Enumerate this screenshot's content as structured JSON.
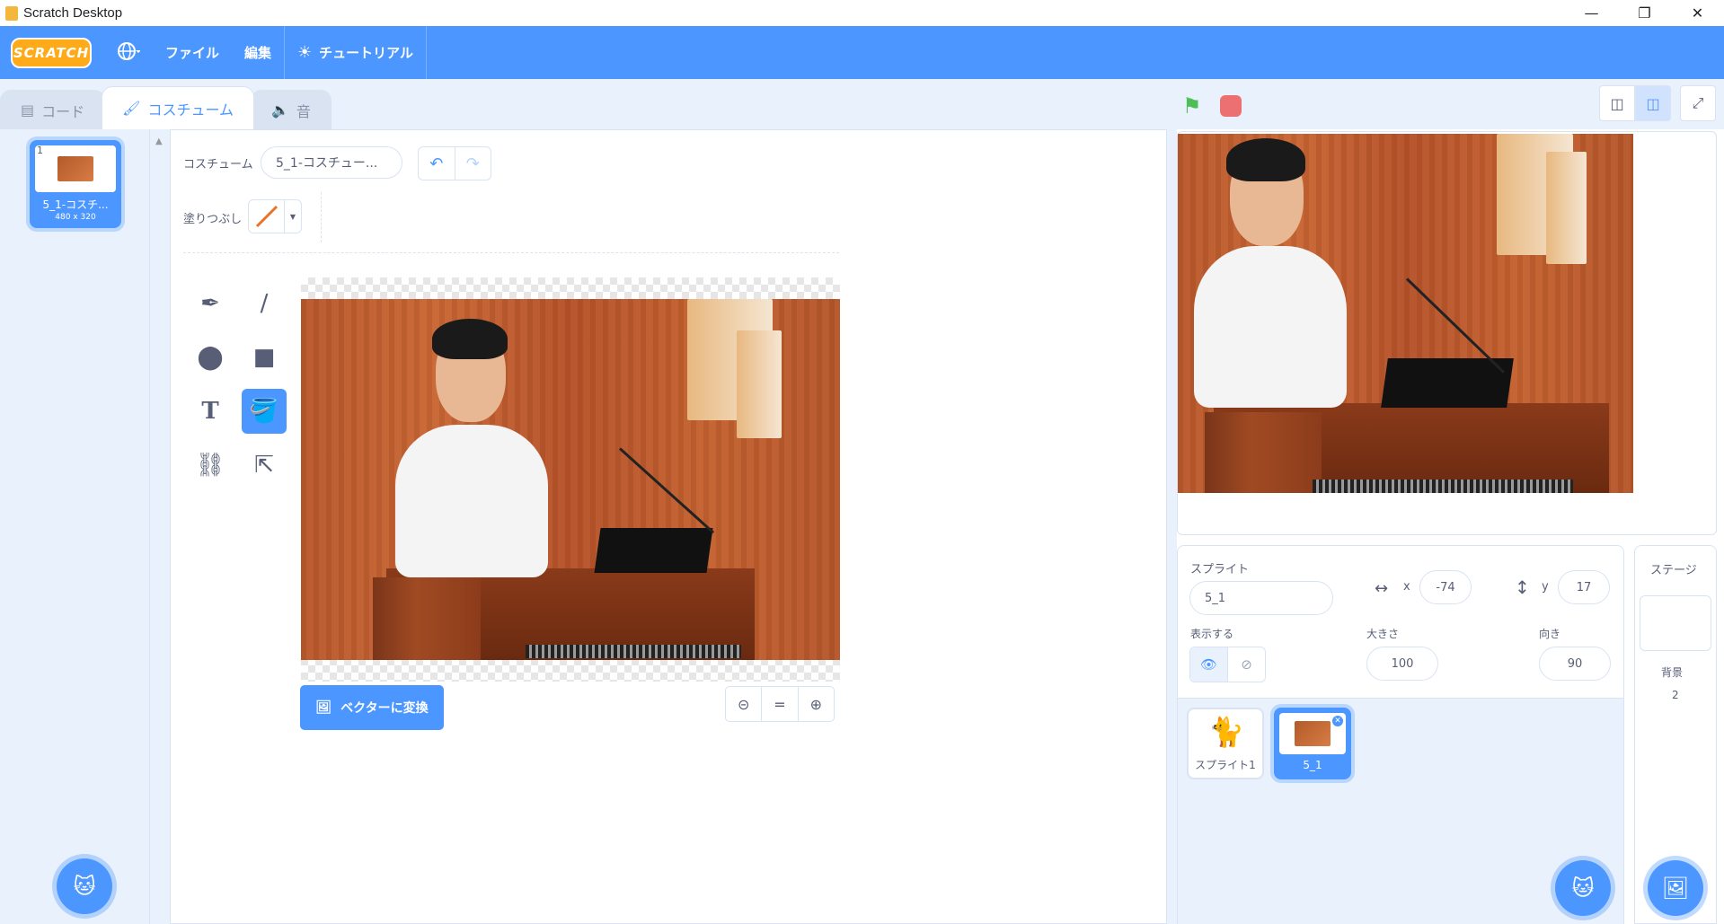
{
  "window": {
    "title": "Scratch Desktop"
  },
  "menu": {
    "logo": "SCRATCH",
    "file": "ファイル",
    "edit": "編集",
    "tutorials": "チュートリアル"
  },
  "tabs": [
    {
      "label": "コード"
    },
    {
      "label": "コスチューム"
    },
    {
      "label": "音"
    }
  ],
  "costumes": [
    {
      "index": "1",
      "name": "5_1-コスチ...",
      "size": "480 x 320"
    }
  ],
  "paint": {
    "costume_label": "コスチューム",
    "costume_name": "5_1-コスチュー...",
    "fill_label": "塗りつぶし",
    "fill_color": "#e8722c",
    "convert_label": "ベクターに変換",
    "zoom_reset": "="
  },
  "sprite": {
    "label": "スプライト",
    "name": "5_1",
    "x_label": "x",
    "x": "-74",
    "y_label": "y",
    "y": "17",
    "show_label": "表示する",
    "size_label": "大きさ",
    "size": "100",
    "direction_label": "向き",
    "direction": "90"
  },
  "sprites": [
    {
      "name": "スプライト1"
    },
    {
      "name": "5_1"
    }
  ],
  "stage": {
    "label": "ステージ",
    "backdrops_label": "背景",
    "backdrops_count": "2"
  },
  "colors": {
    "accent": "#4c97ff",
    "flag": "#4cbf56",
    "stop": "#ec5959"
  }
}
